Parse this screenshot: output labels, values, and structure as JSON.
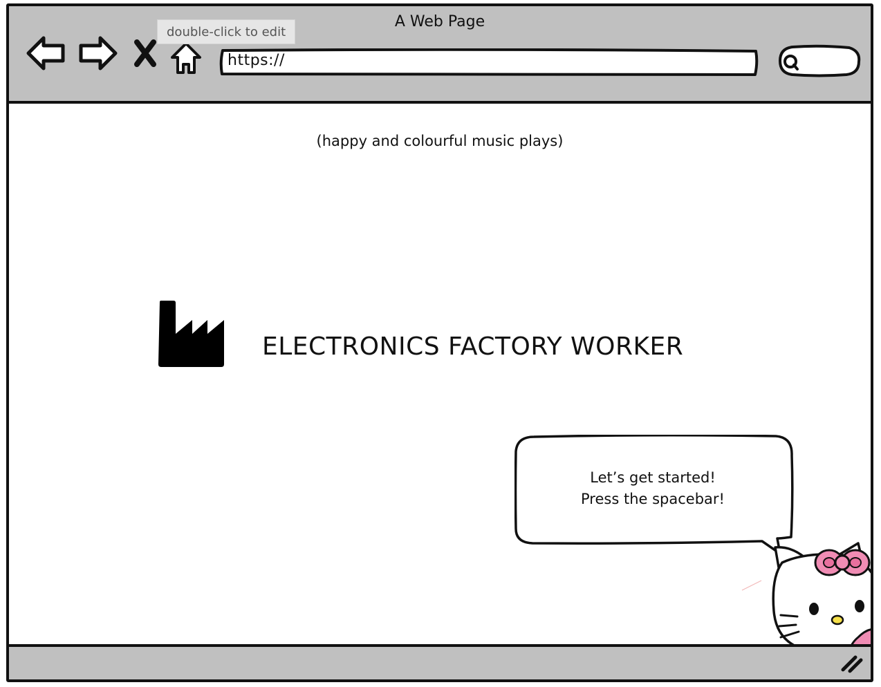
{
  "window": {
    "title": "A Web Page"
  },
  "toolbar": {
    "back_icon": "back-arrow-icon",
    "forward_icon": "forward-arrow-icon",
    "stop_icon": "close-icon",
    "home_icon": "home-icon",
    "tooltip": "double-click to edit"
  },
  "address_bar": {
    "value": "https://"
  },
  "search": {
    "icon": "search-icon"
  },
  "page": {
    "music_caption": "(happy and colourful music plays)",
    "factory_icon": "factory-icon",
    "heading": "ELECTRONICS FACTORY WORKER",
    "speech": {
      "line1": "Let’s get started!",
      "line2": "Press the spacebar!"
    },
    "mascot": "cat-mascot-with-pink-bow"
  },
  "statusbar": {
    "grip_icon": "resize-grip-icon"
  }
}
